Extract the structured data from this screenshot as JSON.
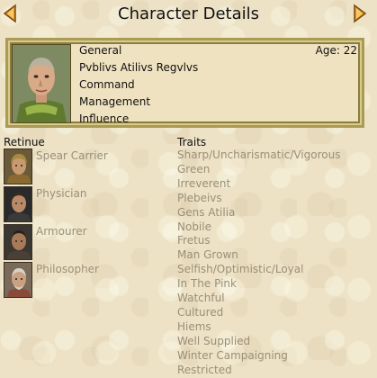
{
  "header": {
    "title": "Character Details"
  },
  "character": {
    "rank": "General",
    "name": "Pvblivs Atilivs Regvlvs",
    "age": "Age: 22",
    "attributes": [
      "Command",
      "Management",
      "Influence"
    ]
  },
  "retinue": {
    "heading": "Retinue",
    "items": [
      "Spear Carrier",
      "Physician",
      "Armourer",
      "Philosopher"
    ]
  },
  "traits": {
    "heading": "Traits",
    "items": [
      "Sharp/Uncharismatic/Vigorous",
      "Green",
      "Irreverent",
      "Plebeivs",
      "Gens Atilia",
      "Nobile",
      "Fretus",
      "Man Grown",
      "Selfish/Optimistic/Loyal",
      "In The Pink",
      "Watchful",
      "Cultured",
      "Hiems",
      "Well Supplied",
      "Winter Campaigning",
      "Restricted"
    ]
  },
  "colors": {
    "background": "#ede2c6",
    "panel_border": "#a99a55",
    "muted_text": "#9a8f78",
    "arrow": "#c07818"
  },
  "icons": {
    "prev": "arrow-left-icon",
    "next": "arrow-right-icon"
  }
}
